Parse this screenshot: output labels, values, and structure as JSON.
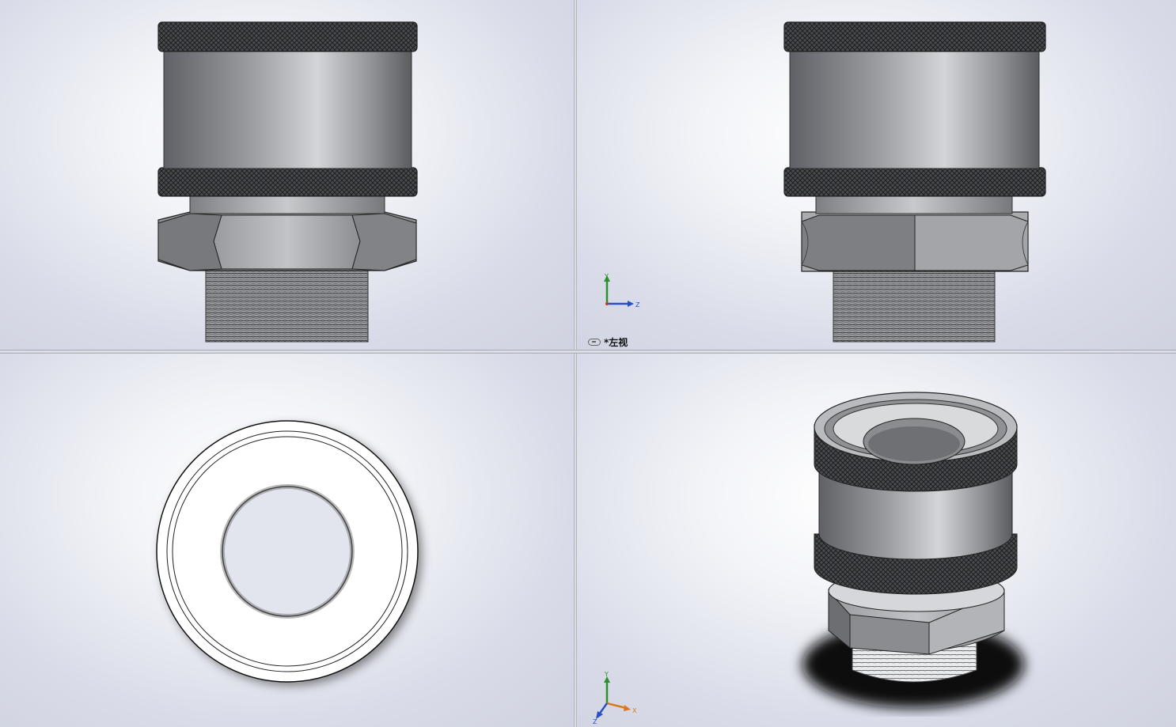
{
  "viewports": {
    "top_right": {
      "view_label": "*左视"
    },
    "bottom_right": {}
  },
  "triad": {
    "x_label": "X",
    "y_label": "Y",
    "z_label": "Z"
  },
  "colors": {
    "background_center": "#ffffff",
    "background_edge": "#cfd2df",
    "metal_dark": "#5f6166",
    "metal_light": "#d4d5d8",
    "knurl": "#3a3b3e",
    "axis_x": "#c23b22",
    "axis_y": "#2f8f2f",
    "axis_z": "#2a4fc2",
    "axis_x_iso": "#d97a1c"
  }
}
